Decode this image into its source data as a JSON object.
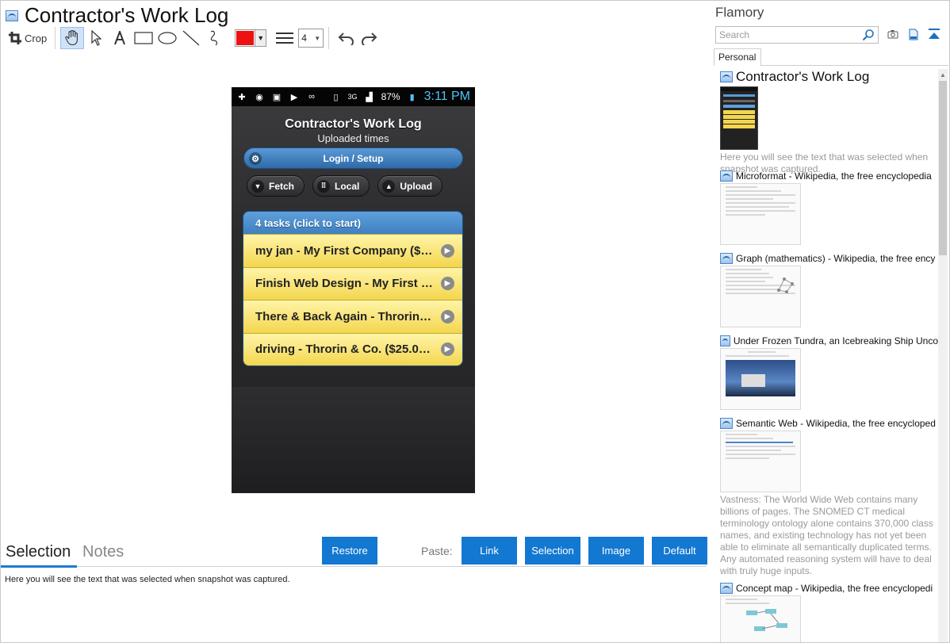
{
  "document": {
    "title": "Contractor's Work Log"
  },
  "toolbar": {
    "crop_label": "Crop",
    "icons": [
      "hand-icon",
      "pointer-icon",
      "text-icon",
      "rectangle-icon",
      "ellipse-icon",
      "line-icon",
      "freehand-icon"
    ],
    "color": "#ee1111",
    "line_width": "4"
  },
  "phone": {
    "status": {
      "battery": "87%",
      "time": "3:11 PM",
      "network": "3G"
    },
    "app_title": "Contractor's Work Log",
    "app_subtitle": "Uploaded times",
    "login_label": "Login / Setup",
    "actions": [
      {
        "label": "Fetch",
        "icon": "chevron-down-icon"
      },
      {
        "label": "Local",
        "icon": "grid-icon"
      },
      {
        "label": "Upload",
        "icon": "chevron-up-icon"
      }
    ],
    "task_header": "4 tasks (click to start)",
    "tasks": [
      "my jan - My First Company ($2...",
      "Finish Web Design - My First C...",
      "There & Back Again - Throrin &...",
      "driving - Throrin & Co. ($25.00..."
    ]
  },
  "bottom": {
    "tabs": [
      "Selection",
      "Notes"
    ],
    "restore_label": "Restore",
    "paste_label": "Paste:",
    "paste_buttons": [
      "Link",
      "Selection",
      "Image",
      "Default"
    ],
    "selection_text": "Here you will see the text that was selected when snapshot was captured."
  },
  "sidebar": {
    "app_name": "Flamory",
    "search_placeholder": "Search",
    "tab": "Personal",
    "entries": [
      {
        "title": "Contractor's Work Log",
        "desc": "Here you will see the text that was selected when snapshot was captured."
      },
      {
        "title": "Microformat - Wikipedia, the free encyclopedia",
        "desc": ""
      },
      {
        "title": "Graph (mathematics) - Wikipedia, the free ency",
        "desc": ""
      },
      {
        "title": "Under Frozen Tundra, an Icebreaking Ship Unco",
        "desc": ""
      },
      {
        "title": "Semantic Web - Wikipedia, the free encycloped",
        "desc": "Vastness: The World Wide Web contains many billions of pages. The SNOMED CT medical terminology ontology alone contains 370,000 class names, and existing technology has not yet been able to eliminate all semantically duplicated terms. Any automated reasoning system will have to deal with truly huge inputs."
      },
      {
        "title": "Concept map - Wikipedia, the free encyclopedi",
        "desc": ""
      }
    ]
  },
  "colors": {
    "accent": "#1278d2",
    "task_yellow": "#f3d64e",
    "phone_blue": "#3f7fbf"
  }
}
